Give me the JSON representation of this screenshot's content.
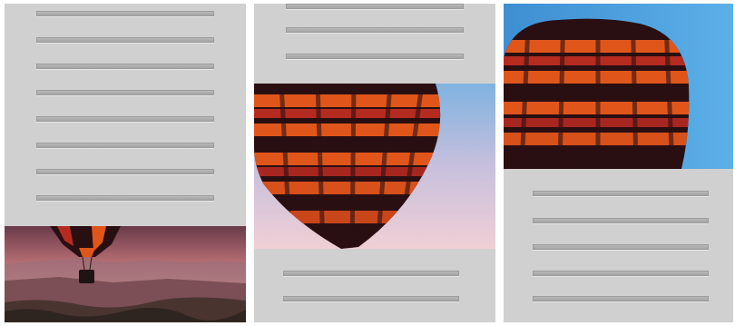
{
  "panels": [
    {
      "name": "left",
      "placeholder_lines": 8,
      "image": "balloon-landscape"
    },
    {
      "name": "middle",
      "placeholder_lines": 5,
      "image": "balloon-envelope-closeup"
    },
    {
      "name": "right",
      "placeholder_lines": 5,
      "image": "balloon-envelope-top"
    }
  ],
  "colors": {
    "panel": "#d0d0d0",
    "placeholder_line": "#aaaaaa",
    "balloon_dark": "#2a0f12",
    "balloon_orange": "#e0561a",
    "balloon_red": "#b52b1f",
    "sky_blue": "#4aa3e0",
    "sky_pink": "#e9c7cf"
  }
}
